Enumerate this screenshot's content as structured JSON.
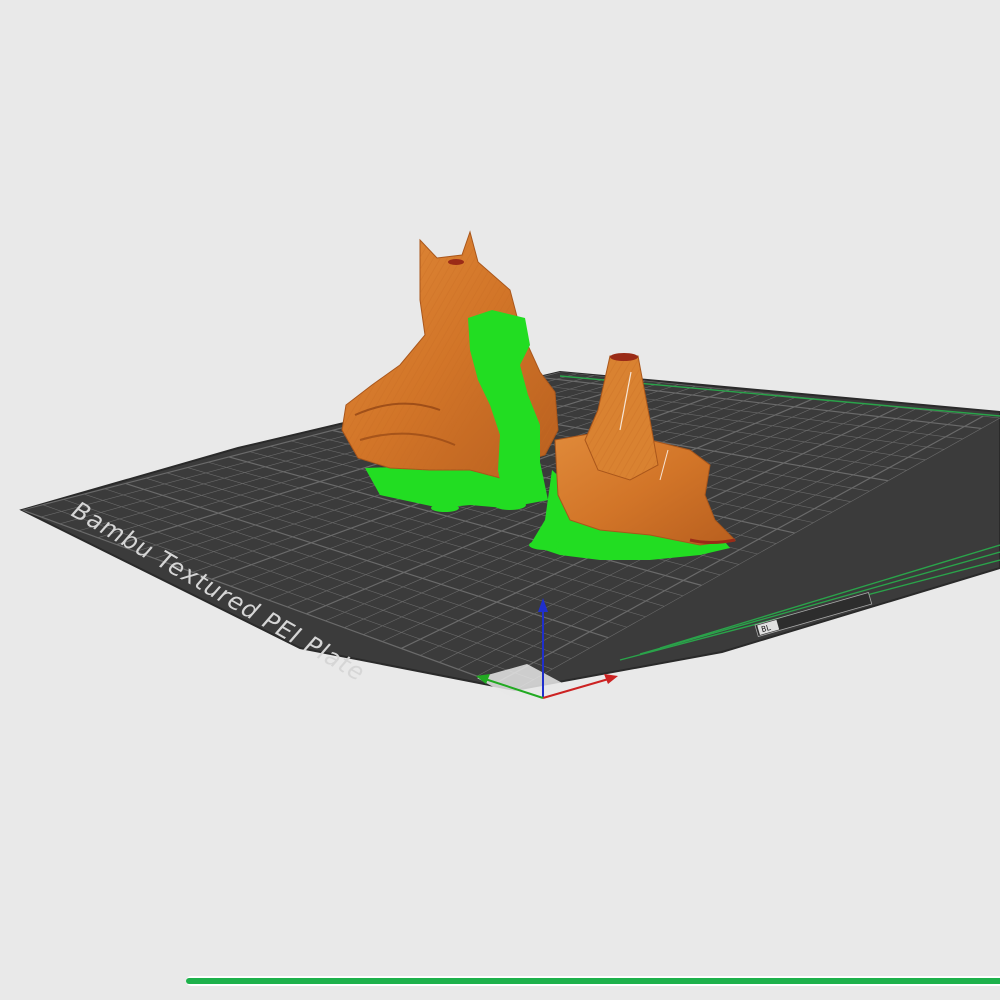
{
  "viewport": {
    "plate_name": "Bambu Textured PEI Plate",
    "plate_brand_mark": "BL",
    "colors": {
      "background": "#e9e9e9",
      "plate": "#3b3b3b",
      "grid": "#6a6a6a",
      "model": "#d57a2c",
      "model_shade": "#b45f1f",
      "support": "#22dd22",
      "axis_x": "#cc2222",
      "axis_y": "#22aa22",
      "axis_z": "#1f2fcc"
    },
    "objects": [
      {
        "name": "horned-figure-model",
        "icon": "model-mesh"
      },
      {
        "name": "cone-rock-model",
        "icon": "model-mesh"
      }
    ]
  },
  "progress": {
    "value": 1.0,
    "color": "#1db14b"
  }
}
